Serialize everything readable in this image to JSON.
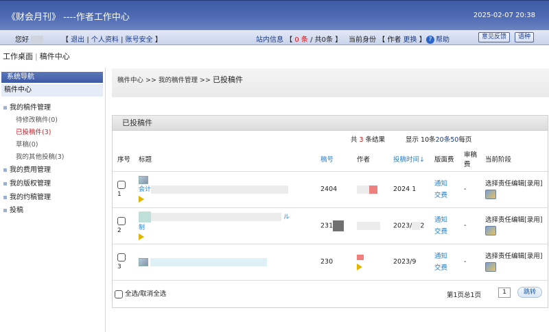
{
  "header": {
    "title": "《财会月刊》 ----作者工作中心",
    "datetime": "2025-02-07 20:38"
  },
  "userbar": {
    "greeting": "您好",
    "logout": "退出",
    "profile": "个人资料",
    "security": "账号安全",
    "site_msg_label": "站内信息",
    "site_msg_count": "0 条",
    "site_msg_total": "共0条",
    "identity_label": "当前身份",
    "identity_value": "作者",
    "identity_switch": "更换",
    "help": "帮助",
    "feedback_btn": "意见反馈",
    "language_btn": "语种"
  },
  "workbench": {
    "desk": "工作桌面",
    "center": "稿件中心"
  },
  "sidebar": {
    "heading": "系统导航",
    "section": "稿件中心",
    "items": [
      {
        "label": "我的稿件管理"
      },
      {
        "label": "待修改稿件(0)"
      },
      {
        "label": "已投稿件(3)"
      },
      {
        "label": "草稿(0)"
      },
      {
        "label": "我的其他投稿(3)"
      },
      {
        "label": "我的费用管理"
      },
      {
        "label": "我的版权管理"
      },
      {
        "label": "我的约稿管理"
      },
      {
        "label": "投稿"
      }
    ]
  },
  "breadcrumb": {
    "level1": "稿件中心",
    "level2": "我的稿件管理",
    "current": "已投稿件",
    "sep": ">>"
  },
  "panel": {
    "title": "已投稿件",
    "result_prefix": "共",
    "result_count": "3",
    "result_suffix": "条结果",
    "display_prefix": "显示",
    "display_10": "10条",
    "display_20": "20条",
    "display_50": "50",
    "display_suffix": "每页"
  },
  "table": {
    "headers": {
      "no": "序号",
      "title": "标题",
      "manuscript_no": "稿号",
      "author": "作者",
      "submit_time": "投稿时间↓",
      "page_fee": "版面费",
      "review_fee": "审稿费",
      "stage": "当前阶段"
    },
    "rows": [
      {
        "no": "1",
        "title": "会计",
        "manuscript_no": "2404",
        "submit_time": "2024",
        "time_tail": "1",
        "fee_line1": "通知",
        "fee_line2": "交费",
        "review": "-",
        "stage": "选择责任编辑[录用]"
      },
      {
        "no": "2",
        "title": "制",
        "title_mark": "ル",
        "manuscript_no": "231",
        "submit_time": "2023/",
        "time_tail": "2",
        "fee_line1": "通知",
        "fee_line2": "交费",
        "review": "-",
        "stage": "选择责任编辑[录用]"
      },
      {
        "no": "3",
        "title": "",
        "manuscript_no": "230",
        "submit_time": "2023/9",
        "time_tail": "",
        "fee_line1": "通知",
        "fee_line2": "交费",
        "review": "-",
        "stage": "选择责任编辑[录用]"
      }
    ]
  },
  "footer": {
    "select_all": "全选/取消全选",
    "page_info": "第1页总1页",
    "page_input": "1",
    "go_btn": "跳转"
  },
  "icons": [
    "help-icon",
    "document-icon",
    "play-icon",
    "edit-icon",
    "checkbox-icon"
  ],
  "colors": {
    "header": "#3d5aa6",
    "accent_red": "#d11111",
    "link_blue": "#2a7fc9"
  }
}
